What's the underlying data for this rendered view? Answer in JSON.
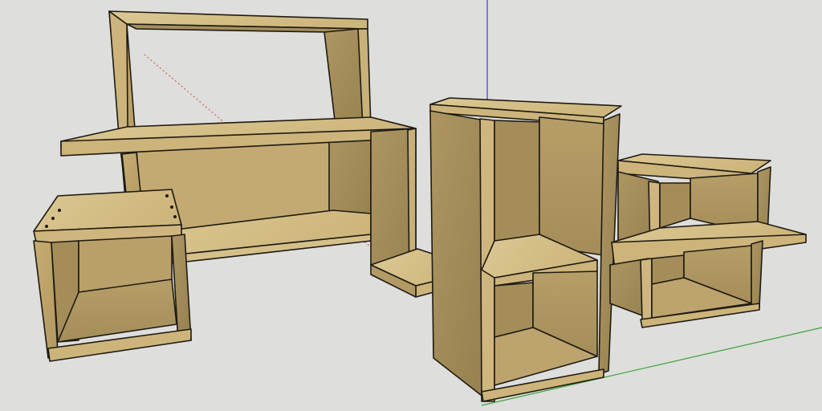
{
  "scene": {
    "background": "#dededc",
    "colors": {
      "wood_top": "#d9c48e",
      "wood_front": "#bfa56c",
      "wood_side": "#a38d5c",
      "wood_dark": "#8e7a4d",
      "edge": "#1e1a12",
      "axis_red": "#d24a3a",
      "axis_green": "#3aa23a",
      "axis_blue": "#3a3ad2"
    }
  }
}
